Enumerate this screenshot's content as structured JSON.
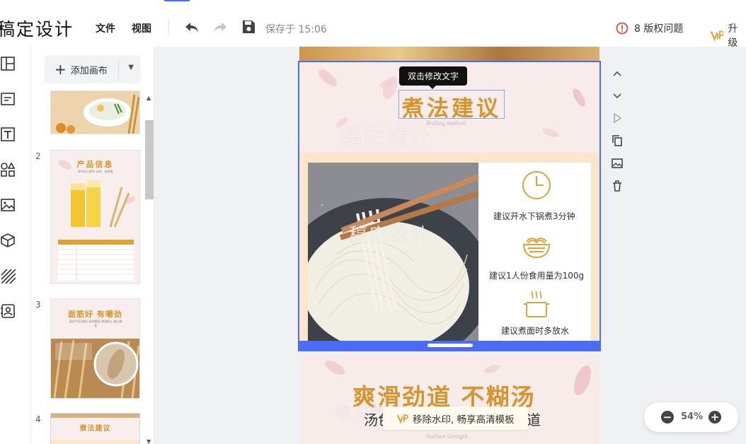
{
  "header": {
    "logo": "稿定设计",
    "menu": [
      "文件",
      "视图"
    ],
    "saved": "保存于 15:06",
    "issues": "8 版权问题",
    "upgrade": "升级"
  },
  "pages_panel": {
    "add_canvas": "添加画布",
    "pages": [
      {
        "number": "2",
        "thumb_title": "产品信息",
        "thumb_sub": "36年匠心制作 好吃 · 耐炖煮"
      },
      {
        "number": "3",
        "thumb_title": "面筋好 有嚼劲",
        "thumb_sub": "麦流弓匠面制小麦穿翻面 弹道筋斗 美丸嚼劲"
      },
      {
        "number": "4",
        "thumb_title": "煮法建议"
      }
    ]
  },
  "canvas": {
    "tooltip": "双击修改文字",
    "title": "煮法建议",
    "subtitle": "Boiling method",
    "watermark": "稿定设计",
    "tips": [
      "建议开水下锅煮3分钟",
      "建议1人份食用量为100g",
      "建议煮面时多放水"
    ],
    "next_title": "爽滑劲道 不糊汤",
    "next_line_left": "汤色",
    "next_line_right": "道",
    "next_footer": "Surface strength",
    "promo": "移除水印, 畅享高清模板"
  },
  "zoom": {
    "value": "54%"
  },
  "colors": {
    "accent": "#4a6cf7",
    "gold": "#d6952e",
    "warning": "#e0493b"
  }
}
